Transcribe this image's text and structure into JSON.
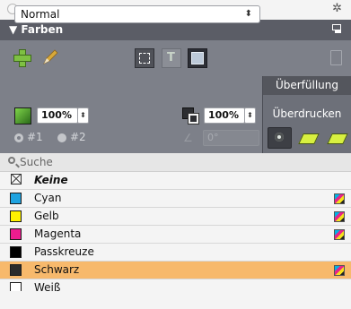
{
  "panel": {
    "title": "Farben",
    "title_prefix": "▼"
  },
  "controls": {
    "blend_mode": "Normal",
    "fill_tint": "100%",
    "stroke_tint": "100%",
    "radio1_label": "#1",
    "radio2_label": "#2",
    "radio1_selected": true,
    "angle": "0°"
  },
  "overprint": {
    "header": "Überfüllung",
    "label": "Überdrucken"
  },
  "search": {
    "placeholder": "Suche"
  },
  "swatches": [
    {
      "name": "Keine",
      "color": "none",
      "cmyk": false,
      "selected": false
    },
    {
      "name": "Cyan",
      "color": "#1fa3e0",
      "cmyk": true,
      "selected": false
    },
    {
      "name": "Gelb",
      "color": "#fff200",
      "cmyk": true,
      "selected": false
    },
    {
      "name": "Magenta",
      "color": "#ec1c8e",
      "cmyk": true,
      "selected": false
    },
    {
      "name": "Passkreuze",
      "color": "#000000",
      "cmyk": false,
      "selected": false
    },
    {
      "name": "Schwarz",
      "color": "#2b2b2b",
      "cmyk": true,
      "selected": true
    },
    {
      "name": "Weiß",
      "color": "#ffffff",
      "cmyk": false,
      "selected": false
    }
  ],
  "colors": {
    "titlebar": "#5b5d66",
    "panel_bg": "#7d8089",
    "selection": "#f7b96c",
    "add_icon": "#7ec043"
  }
}
